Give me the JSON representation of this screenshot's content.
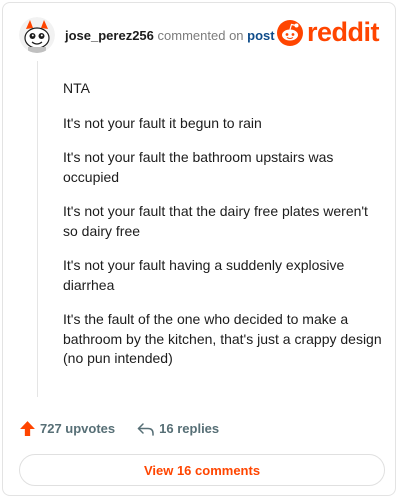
{
  "colors": {
    "brand": "#ff4500",
    "post_link": "#0f4c8a",
    "muted": "#576f76"
  },
  "header": {
    "username": "jose_perez256",
    "action_text": "commented on",
    "post_link": "post",
    "avatar_icon": "snoo-avatar-icon"
  },
  "logo": {
    "icon": "snoo-icon",
    "wordmark": "reddit"
  },
  "comment": {
    "paragraphs": [
      "NTA",
      "It's not your fault it begun to rain",
      "It's not your fault the bathroom upstairs was occupied",
      "It's not your fault that the dairy free plates weren't so dairy free",
      "It's not your fault having a suddenly explosive diarrhea",
      "It's the fault of the one who decided to make a bathroom by the kitchen, that's just a crappy design (no pun intended)"
    ]
  },
  "actions": {
    "upvotes_label": "727 upvotes",
    "replies_label": "16 replies",
    "upvote_icon": "upvote-arrow-icon",
    "reply_icon": "reply-arrow-icon"
  },
  "view_comments_label": "View 16 comments"
}
